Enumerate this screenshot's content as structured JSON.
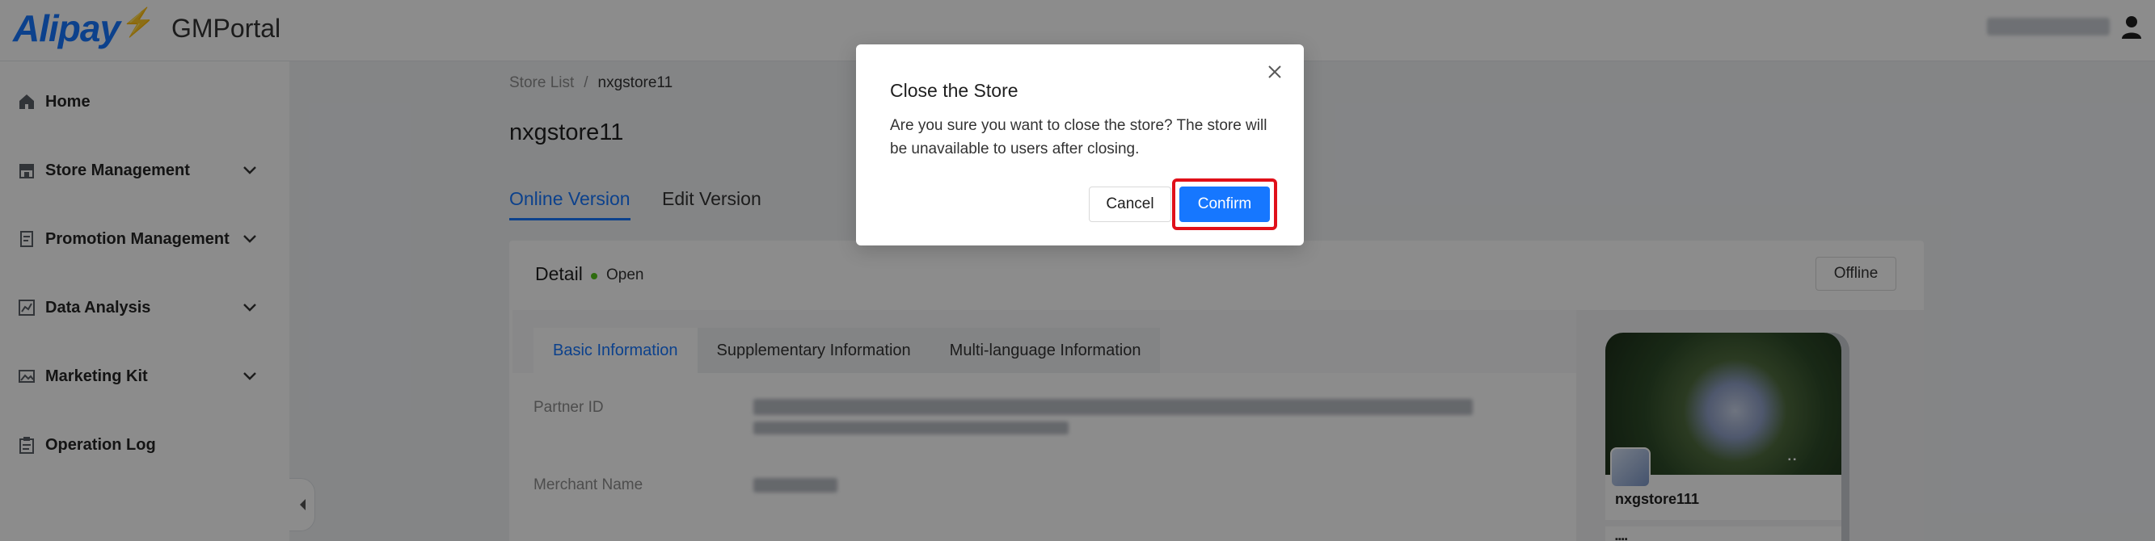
{
  "header": {
    "logo": "Alipay",
    "portal_name": "GMPortal",
    "icons": {
      "logo_mark": "bolt-icon",
      "user": "user-icon"
    }
  },
  "sidebar": {
    "items": [
      {
        "label": "Home",
        "icon": "home-icon",
        "has_submenu": false
      },
      {
        "label": "Store Management",
        "icon": "store-icon",
        "has_submenu": true
      },
      {
        "label": "Promotion Management",
        "icon": "document-icon",
        "has_submenu": true
      },
      {
        "label": "Data Analysis",
        "icon": "chart-icon",
        "has_submenu": true
      },
      {
        "label": "Marketing Kit",
        "icon": "image-icon",
        "has_submenu": true
      },
      {
        "label": "Operation Log",
        "icon": "clipboard-icon",
        "has_submenu": false
      }
    ]
  },
  "breadcrumb": {
    "parent": "Store List",
    "separator": "/",
    "current": "nxgstore11"
  },
  "page": {
    "title": "nxgstore11",
    "version_tabs": [
      {
        "label": "Online Version",
        "active": true
      },
      {
        "label": "Edit Version",
        "active": false
      }
    ]
  },
  "detail": {
    "title": "Detail",
    "status": "Open",
    "status_color": "#52c41a",
    "offline_label": "Offline",
    "info_tabs": [
      {
        "label": "Basic Information",
        "active": true
      },
      {
        "label": "Supplementary Information",
        "active": false
      },
      {
        "label": "Multi-language Information",
        "active": false
      }
    ],
    "fields": [
      {
        "label": "Partner ID"
      },
      {
        "label": "Merchant Name"
      }
    ]
  },
  "preview": {
    "store_name": "nxgstore111"
  },
  "modal": {
    "title": "Close the Store",
    "body": "Are you sure you want to close the store? The store will be unavailable to users after closing.",
    "cancel_label": "Cancel",
    "confirm_label": "Confirm",
    "highlight_color": "#e0101a"
  },
  "colors": {
    "accent": "#1677ff",
    "overlay": "rgba(0,0,0,0.45)"
  }
}
